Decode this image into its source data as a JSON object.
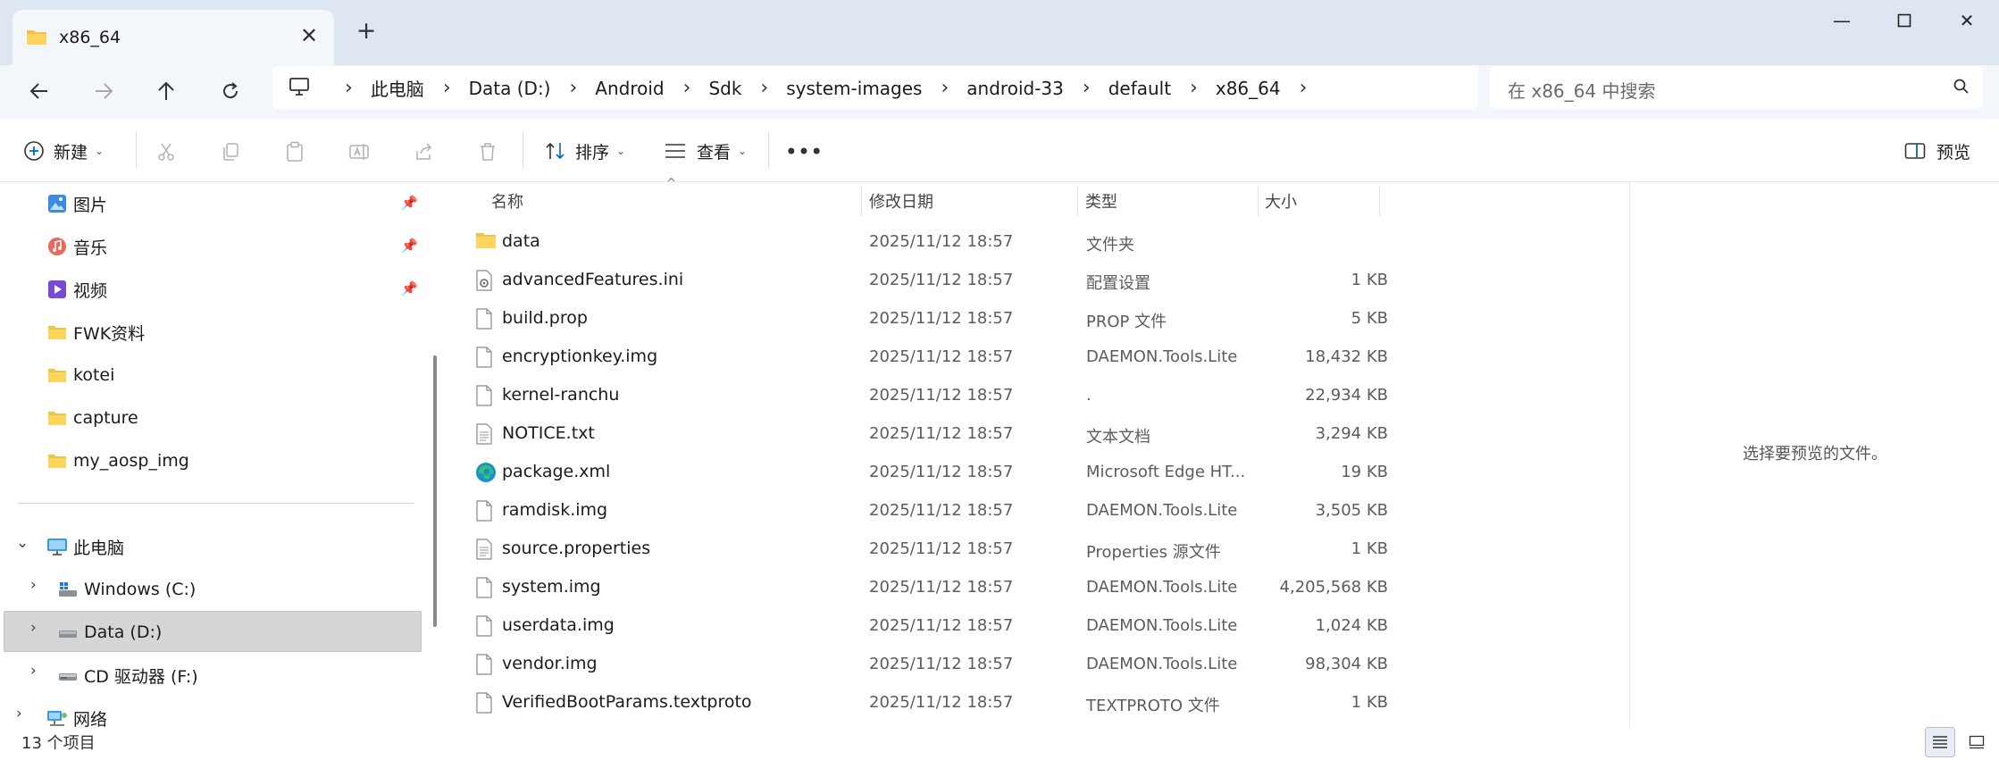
{
  "tab": {
    "title": "x86_64"
  },
  "address": {
    "crumbs": [
      "此电脑",
      "Data (D:)",
      "Android",
      "Sdk",
      "system-images",
      "android-33",
      "default",
      "x86_64"
    ]
  },
  "search": {
    "placeholder": "在 x86_64 中搜索"
  },
  "toolbar": {
    "new_label": "新建",
    "sort_label": "排序",
    "view_label": "查看",
    "preview_label": "预览"
  },
  "nav": {
    "quick": [
      {
        "label": "图片",
        "icon": "pictures-icon",
        "pinned": true
      },
      {
        "label": "音乐",
        "icon": "music-icon",
        "pinned": true
      },
      {
        "label": "视频",
        "icon": "videos-icon",
        "pinned": true
      },
      {
        "label": "FWK资料",
        "icon": "folder-icon",
        "pinned": false
      },
      {
        "label": "kotei",
        "icon": "folder-icon",
        "pinned": false
      },
      {
        "label": "capture",
        "icon": "folder-icon",
        "pinned": false
      },
      {
        "label": "my_aosp_img",
        "icon": "folder-icon",
        "pinned": false
      }
    ],
    "this_pc": "此电脑",
    "drives": [
      {
        "label": "Windows (C:)",
        "icon": "windows-drive-icon"
      },
      {
        "label": "Data (D:)",
        "icon": "drive-icon",
        "selected": true
      },
      {
        "label": "CD 驱动器 (F:)",
        "icon": "cd-drive-icon"
      }
    ],
    "network": "网络"
  },
  "columns": {
    "name": "名称",
    "date": "修改日期",
    "type": "类型",
    "size": "大小"
  },
  "files": [
    {
      "name": "data",
      "date": "2025/11/12 18:57",
      "type": "文件夹",
      "size": "",
      "icon": "folder"
    },
    {
      "name": "advancedFeatures.ini",
      "date": "2025/11/12 18:57",
      "type": "配置设置",
      "size": "1 KB",
      "icon": "settings"
    },
    {
      "name": "build.prop",
      "date": "2025/11/12 18:57",
      "type": "PROP 文件",
      "size": "5 KB",
      "icon": "file"
    },
    {
      "name": "encryptionkey.img",
      "date": "2025/11/12 18:57",
      "type": "DAEMON.Tools.Lite",
      "size": "18,432 KB",
      "icon": "file"
    },
    {
      "name": "kernel-ranchu",
      "date": "2025/11/12 18:57",
      "type": ".",
      "size": "22,934 KB",
      "icon": "file"
    },
    {
      "name": "NOTICE.txt",
      "date": "2025/11/12 18:57",
      "type": "文本文档",
      "size": "3,294 KB",
      "icon": "text"
    },
    {
      "name": "package.xml",
      "date": "2025/11/12 18:57",
      "type": "Microsoft Edge HT...",
      "size": "19 KB",
      "icon": "edge"
    },
    {
      "name": "ramdisk.img",
      "date": "2025/11/12 18:57",
      "type": "DAEMON.Tools.Lite",
      "size": "3,505 KB",
      "icon": "file"
    },
    {
      "name": "source.properties",
      "date": "2025/11/12 18:57",
      "type": "Properties 源文件",
      "size": "1 KB",
      "icon": "text"
    },
    {
      "name": "system.img",
      "date": "2025/11/12 18:57",
      "type": "DAEMON.Tools.Lite",
      "size": "4,205,568 KB",
      "icon": "file"
    },
    {
      "name": "userdata.img",
      "date": "2025/11/12 18:57",
      "type": "DAEMON.Tools.Lite",
      "size": "1,024 KB",
      "icon": "file"
    },
    {
      "name": "vendor.img",
      "date": "2025/11/12 18:57",
      "type": "DAEMON.Tools.Lite",
      "size": "98,304 KB",
      "icon": "file"
    },
    {
      "name": "VerifiedBootParams.textproto",
      "date": "2025/11/12 18:57",
      "type": "TEXTPROTO 文件",
      "size": "1 KB",
      "icon": "file"
    }
  ],
  "preview": {
    "empty_text": "选择要预览的文件。"
  },
  "status": {
    "count": "13 个项目"
  },
  "colors": {
    "accent": "#0067c0",
    "folder": "#f3c24a",
    "selection": "#d6d6d6",
    "titlebar": "#dde6f1"
  }
}
